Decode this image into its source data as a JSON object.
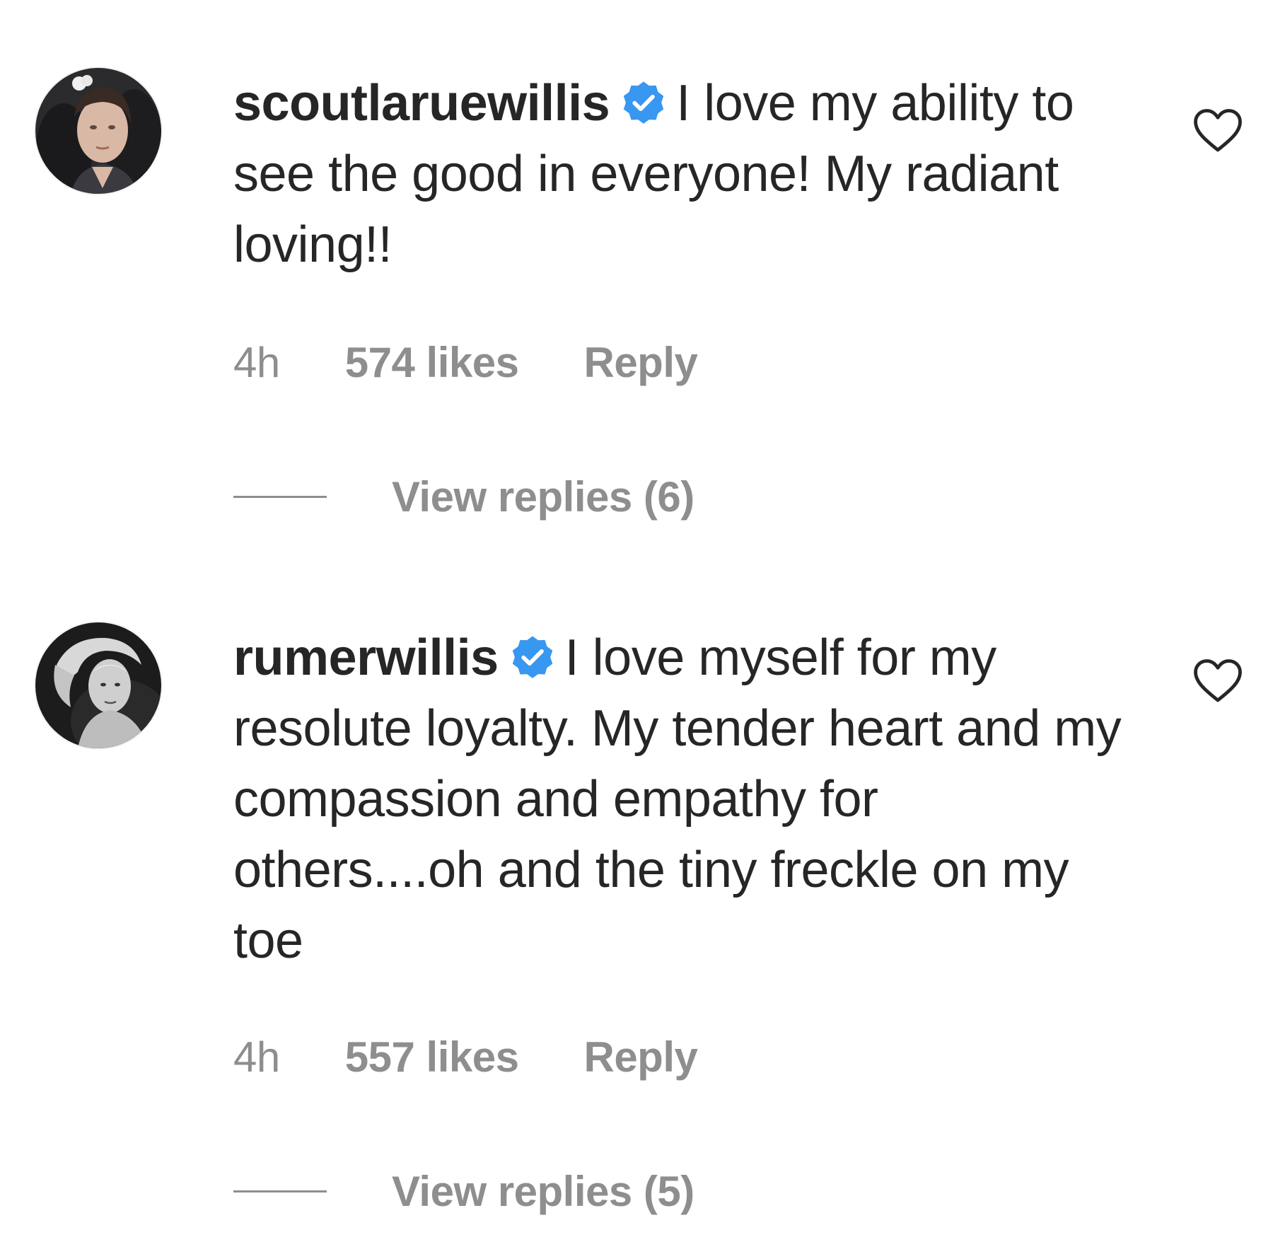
{
  "comments": [
    {
      "username": "scoutlaruewillis",
      "verified": true,
      "text": "I love my ability to see the good in everyone! My radiant loving!!",
      "time": "4h",
      "likes": "574 likes",
      "reply_label": "Reply",
      "view_replies": "View replies (6)",
      "avatar_icon": "profile-photo-avatar",
      "like_icon": "heart-outline-icon"
    },
    {
      "username": "rumerwillis",
      "verified": true,
      "text": "I love myself for my resolute loyalty. My tender heart and my compassion and empathy for others....oh and the tiny freckle on my toe",
      "time": "4h",
      "likes": "557 likes",
      "reply_label": "Reply",
      "view_replies": "View replies (5)",
      "avatar_icon": "profile-photo-avatar",
      "like_icon": "heart-outline-icon"
    }
  ],
  "colors": {
    "text": "#262626",
    "secondary": "#8e8e8e",
    "verified_blue": "#3897f0"
  }
}
